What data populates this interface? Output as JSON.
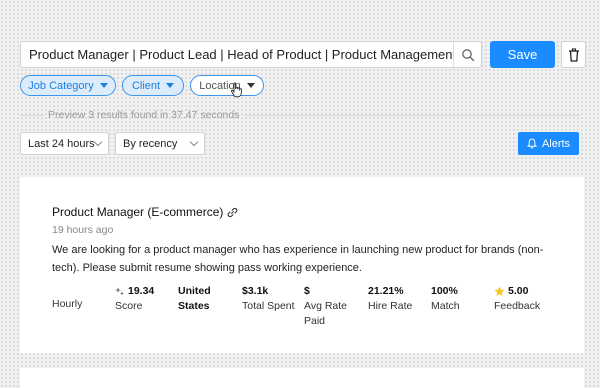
{
  "search": {
    "query": "Product Manager | Product Lead | Head of Product | Product Management"
  },
  "actions": {
    "save_label": "Save"
  },
  "filters": [
    {
      "label": "Job Category",
      "active": true
    },
    {
      "label": "Client",
      "active": true
    },
    {
      "label": "Location",
      "active": false
    }
  ],
  "preview": {
    "text": "Preview 3 results found in 37.47 seconds"
  },
  "controls": {
    "time_range": "Last 24 hours",
    "sort": "By recency",
    "alerts_label": "Alerts"
  },
  "job": {
    "title": "Product Manager (E-commerce)",
    "posted": "19 hours ago",
    "description": "We are looking for a product manager who has experience in launching new product for brands (non-tech). Please submit resume showing pass working experience.",
    "stats": [
      {
        "value": "",
        "label": "Hourly"
      },
      {
        "value": "19.34",
        "label": "Score",
        "icon": "sparkle-icon"
      },
      {
        "value": "United States",
        "label": ""
      },
      {
        "value": "$3.1k",
        "label": "Total Spent"
      },
      {
        "value": "$",
        "label": "Avg Rate Paid"
      },
      {
        "value": "21.21%",
        "label": "Hire Rate"
      },
      {
        "value": "100%",
        "label": "Match"
      },
      {
        "value": "5.00",
        "label": "Feedback",
        "icon": "star-icon"
      }
    ]
  },
  "colors": {
    "accent": "#1a8cff",
    "chip_bg": "#dcecfb",
    "chip_border": "#3d95ee"
  }
}
